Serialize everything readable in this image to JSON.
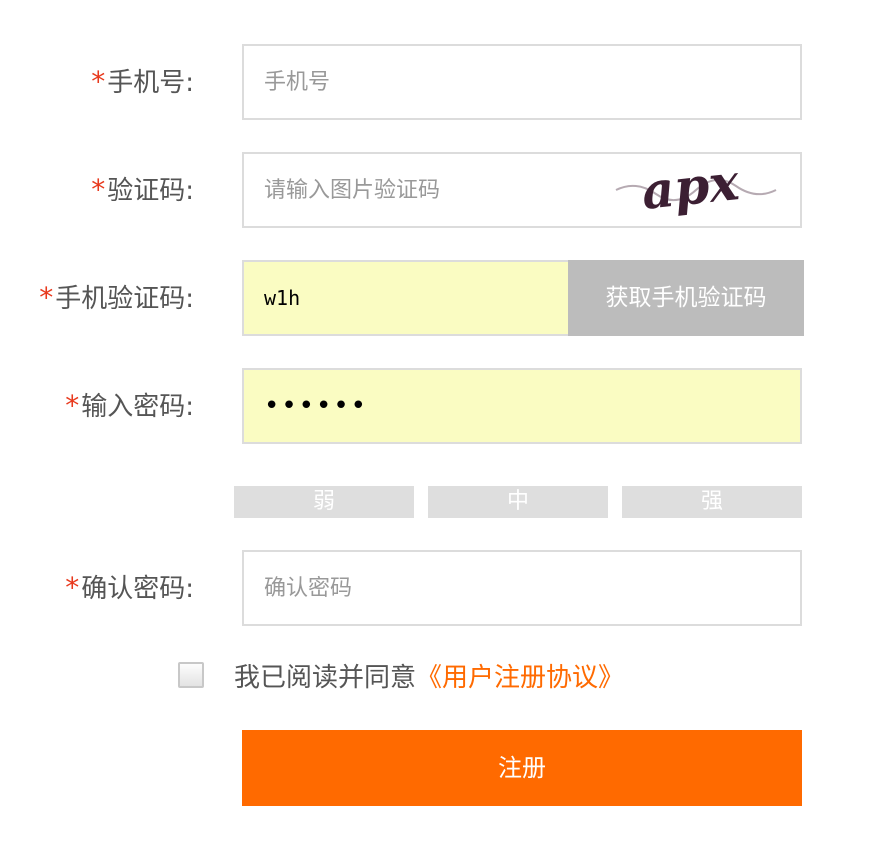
{
  "form": {
    "phone": {
      "label": "手机号:",
      "placeholder": "手机号",
      "value": ""
    },
    "captcha": {
      "label": "验证码:",
      "placeholder": "请输入图片验证码",
      "value": "",
      "image_text": "apx"
    },
    "sms_code": {
      "label": "手机验证码:",
      "value": "w1h",
      "button_label": "获取手机验证码"
    },
    "password": {
      "label": "输入密码:",
      "value": "••••••"
    },
    "strength": {
      "weak": "弱",
      "medium": "中",
      "strong": "强"
    },
    "confirm_password": {
      "label": "确认密码:",
      "placeholder": "确认密码",
      "value": ""
    },
    "required_mark": "*",
    "agreement": {
      "text": "我已阅读并同意",
      "link": "《用户注册协议》",
      "checked": false
    },
    "submit_label": "注册"
  },
  "colors": {
    "accent": "#ff6a00",
    "required": "#e8391d",
    "filled_bg": "#fafcc2",
    "button_gray": "#bcbcbc",
    "strength_gray": "#dedede"
  }
}
